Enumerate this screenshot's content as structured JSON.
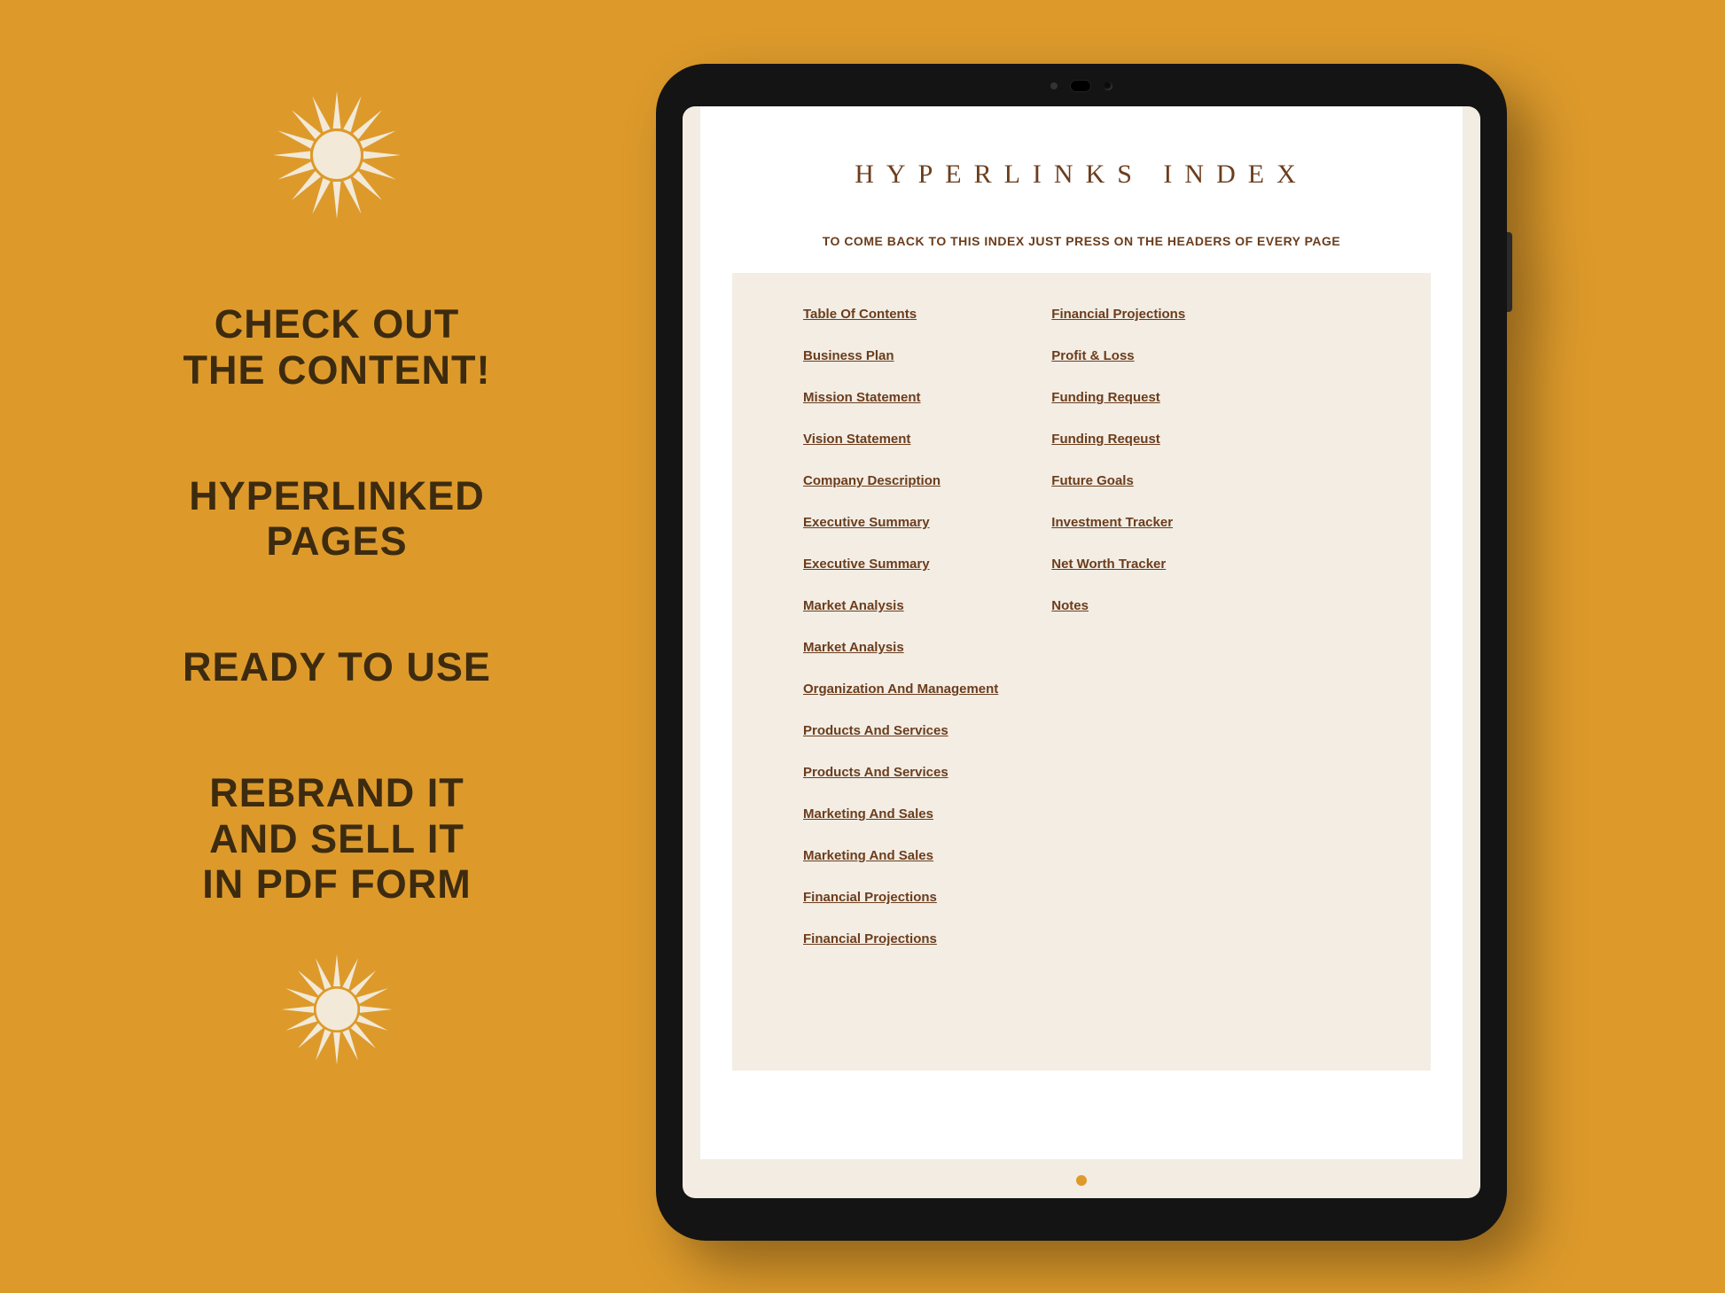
{
  "promo": {
    "line1": "CHECK OUT",
    "line2": "THE CONTENT!",
    "line3": "HYPERLINKED",
    "line4": "PAGES",
    "line5": "READY TO USE",
    "line6": "REBRAND IT",
    "line7": "AND SELL IT",
    "line8": "IN PDF FORM"
  },
  "tablet": {
    "title": "HYPERLINKS INDEX",
    "subtitle": "TO COME BACK TO THIS INDEX JUST PRESS ON THE HEADERS OF EVERY PAGE",
    "columnA": [
      "Table Of Contents",
      "Business Plan",
      "Mission Statement",
      "Vision Statement",
      "Company Description",
      "Executive Summary",
      "Executive Summary",
      "Market Analysis",
      "Market Analysis",
      "Organization And Management",
      "Products And Services",
      "Products And Services",
      "Marketing And Sales",
      "Marketing And Sales",
      "Financial Projections",
      "Financial Projections"
    ],
    "columnB": [
      "Financial Projections",
      "Profit & Loss",
      "Funding Request",
      "Funding Reqeust",
      "Future Goals",
      "Investment Tracker",
      "Net Worth Tracker",
      "Notes"
    ]
  },
  "colors": {
    "background": "#dd9a2b",
    "textDark": "#3d2b10",
    "linkBrown": "#6b3d1c",
    "panel": "#f3ede4",
    "sun": "#f2e9d8"
  }
}
